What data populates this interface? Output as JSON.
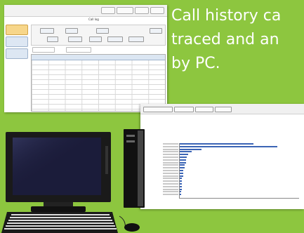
{
  "caption": "Call history ca\ntraced and an\nby PC.",
  "screenshot_call_log": {
    "title": "Call log",
    "top_buttons": [
      "",
      "",
      "",
      ""
    ],
    "sidebar_items": [
      {
        "label": "",
        "active": true
      },
      {
        "label": "",
        "active": false
      },
      {
        "label": "",
        "active": false
      }
    ]
  },
  "screenshot_chart": {
    "toolbar_buttons": [
      "",
      "",
      "",
      ""
    ],
    "chart_data": {
      "type": "bar",
      "orientation": "horizontal",
      "values_relative": [
        0.62,
        0.82,
        0.18,
        0.1,
        0.07,
        0.06,
        0.05,
        0.05,
        0.04,
        0.04,
        0.03,
        0.03,
        0.03,
        0.02,
        0.02,
        0.02,
        0.02,
        0.02,
        0.01,
        0.01
      ],
      "title": "",
      "xlabel": "",
      "ylabel": ""
    },
    "bar_color": "#3b64b5"
  },
  "colors": {
    "background": "#8dc63f",
    "caption_text": "#ffffff"
  }
}
